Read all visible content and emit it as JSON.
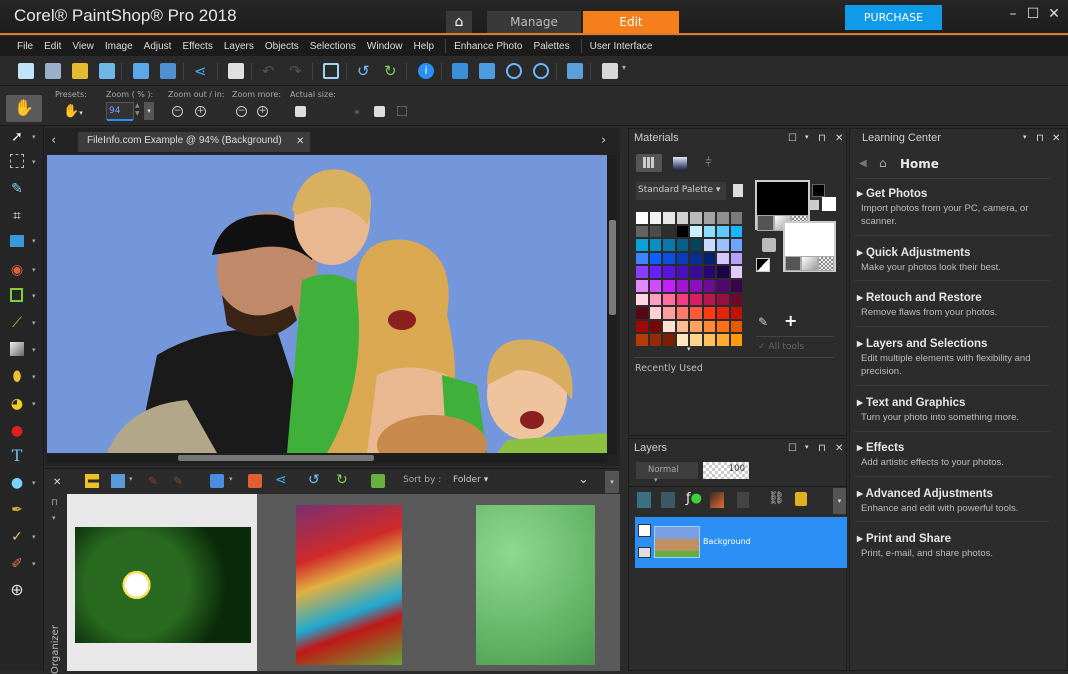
{
  "app": {
    "title": "Corel® PaintShop® Pro 2018"
  },
  "workspace_tabs": [
    {
      "label": "Manage",
      "active": false
    },
    {
      "label": "Edit",
      "active": true
    }
  ],
  "purchase_label": "PURCHASE",
  "window_controls": [
    "minimize-icon",
    "maximize-icon",
    "close-icon"
  ],
  "menu": [
    "File",
    "Edit",
    "View",
    "Image",
    "Adjust",
    "Effects",
    "Layers",
    "Objects",
    "Selections",
    "Window",
    "Help",
    "Enhance Photo",
    "Palettes",
    "User Interface"
  ],
  "toolbar_icons": [
    "new-icon",
    "new-from-template-icon",
    "open-icon",
    "scan-icon",
    "save-icon",
    "save-as-icon",
    "share-icon",
    "print-icon",
    "undo-icon",
    "redo-icon",
    "resize-icon",
    "rotate-left-icon",
    "rotate-right-icon",
    "info-icon",
    "actual-size-icon",
    "fit-window-icon",
    "zoom-out-icon",
    "zoom-in-icon",
    "zoom-fit-icon",
    "paste-icon"
  ],
  "options": {
    "presets_label": "Presets:",
    "zoom_label": "Zoom ( % ):",
    "zoom_value": "94",
    "zoom_out_in_label": "Zoom out / in:",
    "zoom_more_label": "Zoom more:",
    "actual_size_label": "Actual size:"
  },
  "document": {
    "tab_title": "FileInfo.com Example @  94% (Background)"
  },
  "tools": [
    "pan-tool",
    "pick-tool",
    "selection-tool",
    "dropper-tool",
    "crop-tool",
    "straighten-tool",
    "red-eye-tool",
    "perspective-tool",
    "paint-brush-tool",
    "gradient-tool",
    "eraser-tool",
    "fill-tool",
    "color-replacer-tool",
    "text-tool",
    "shape-tool",
    "pen-tool",
    "warp-tool",
    "clone-tool",
    "add-tool"
  ],
  "organizer": {
    "sort_label": "Sort by :",
    "sort_value": "Folder",
    "side_label": "Organizer",
    "thumbnails": [
      "water-lily-photo",
      "vegetable-market-photo",
      "green-leaves-photo"
    ]
  },
  "materials": {
    "title": "Materials",
    "palette_select": "Standard Palette",
    "all_tools_label": "All tools",
    "recently_used_label": "Recently Used",
    "foreground_color": "#000000",
    "background_color": "#ffffff",
    "swatches": [
      "#ffffff",
      "#f2f2f2",
      "#e6e6e6",
      "#d0d0d0",
      "#b9b9b9",
      "#a3a3a3",
      "#8f8f8f",
      "#7b7b7b",
      "#636363",
      "#4b4b4b",
      "#2e2e2e",
      "#000000",
      "#c8f0ff",
      "#8fdcff",
      "#5ccaff",
      "#17b7ff",
      "#0aa0d8",
      "#0b8fc2",
      "#0b78a8",
      "#085e85",
      "#06425c",
      "#c8dcff",
      "#9cc0ff",
      "#6ea6ff",
      "#3a86ff",
      "#1060ff",
      "#0b4fe0",
      "#0a3dbd",
      "#082d96",
      "#052270",
      "#d6c8ff",
      "#b7a0ff",
      "#8a3cff",
      "#6a1fff",
      "#5a14e0",
      "#4a0fbd",
      "#3a0b96",
      "#2a0770",
      "#1d044a",
      "#e4c8ff",
      "#e28aff",
      "#d24cff",
      "#c31fff",
      "#a214d6",
      "#8a0fbd",
      "#6e0b96",
      "#520770",
      "#3a044a",
      "#ffd6e6",
      "#ff9ec0",
      "#ff6ea0",
      "#f53c80",
      "#d61f66",
      "#bd1452",
      "#960f40",
      "#70082e",
      "#5a0618",
      "#ffd0d0",
      "#ff9e9e",
      "#ff7a6a",
      "#ff5a3a",
      "#ff3a14",
      "#e6240a",
      "#c21206",
      "#a00a06",
      "#7a0404",
      "#ffe2d0",
      "#ffbc90",
      "#ffa260",
      "#ff8a36",
      "#ff7014",
      "#e65a06",
      "#b83a06",
      "#962a04",
      "#7a1e04",
      "#ffe8c0",
      "#ffd490",
      "#ffc060",
      "#ffac30",
      "#ff9a0a"
    ]
  },
  "layers": {
    "title": "Layers",
    "blend_mode": "Normal",
    "opacity": "100",
    "items": [
      {
        "name": "Background",
        "selected": true
      }
    ]
  },
  "learning_center": {
    "title": "Learning Center",
    "home_label": "Home",
    "items": [
      {
        "title": "Get Photos",
        "desc": "Import photos from your PC, camera, or scanner."
      },
      {
        "title": "Quick Adjustments",
        "desc": "Make your photos look their best."
      },
      {
        "title": "Retouch and Restore",
        "desc": "Remove flaws from your photos."
      },
      {
        "title": "Layers and Selections",
        "desc": "Edit multiple elements with flexibility and precision."
      },
      {
        "title": "Text and Graphics",
        "desc": "Turn your photo into something more."
      },
      {
        "title": "Effects",
        "desc": "Add artistic effects to your photos."
      },
      {
        "title": "Advanced Adjustments",
        "desc": "Enhance and edit with powerful tools."
      },
      {
        "title": "Print and Share",
        "desc": "Print, e-mail, and share photos."
      }
    ]
  },
  "colors": {
    "accent": "#f57f1b",
    "purchase": "#0f9be8",
    "selection": "#2b8ff5"
  }
}
